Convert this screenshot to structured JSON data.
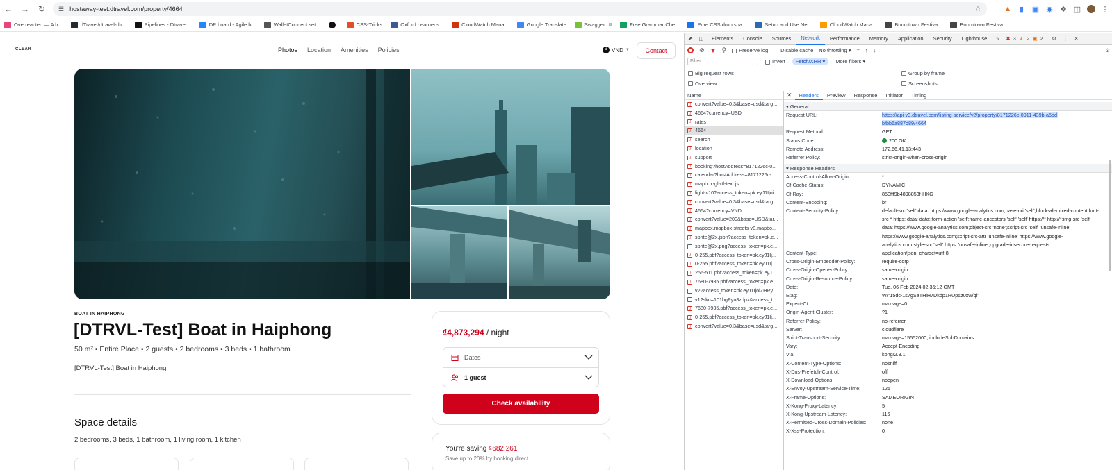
{
  "browser": {
    "url": "hostaway-test.dtravel.com/property/4664",
    "bookmarks": [
      "Overreacted — A b...",
      "dTravel/dtravel-dir...",
      "Pipelines - Dtravel...",
      "DP board - Agile b...",
      "WalletConnect set...",
      "",
      "CSS-Tricks",
      "Oxford Learner's...",
      "CloudWatch Mana...",
      "Google Translate",
      "Swagger UI",
      "Free Grammar Che...",
      "Pure CSS drop sha...",
      "Setup and Use Ne...",
      "CloudWatch Mana...",
      "Boomtown Festiva...",
      "Boomtown Festiva..."
    ],
    "bookmark_colors": [
      "#e8457a",
      "#24292e",
      "#111",
      "#2684ff",
      "#555",
      "#111",
      "#e44d26",
      "#3b5998",
      "#d13212",
      "#4285f4",
      "#7ac142",
      "#15a15d",
      "#1a73e8",
      "#2b6cb0",
      "#ff9900",
      "#444",
      "#444"
    ]
  },
  "site": {
    "logo": "CLEAR",
    "nav": [
      "Photos",
      "Location",
      "Amenities",
      "Policies"
    ],
    "currency": "VND",
    "contact": "Contact",
    "subtitle": "BOAT IN HAIPHONG",
    "title": "[DTRVL-Test] Boat in Haiphong",
    "facts": "50 m² • Entire Place • 2 guests • 2 bedrooms • 3 beds • 1 bathroom",
    "description": "[DTRVL-Test] Boat in Haiphong",
    "space_title": "Space details",
    "space_details": "2 bedrooms, 3 beds, 1 bathroom, 1 living room, 1 kitchen",
    "booking": {
      "price": "₫4,873,294",
      "per": " / night",
      "dates": "Dates",
      "guests": "1 guest",
      "cta": "Check availability"
    },
    "saving": {
      "label": "You're saving ",
      "amount": "₫682,261",
      "note": "Save up to 20% by booking direct"
    }
  },
  "devtools": {
    "tabs": [
      "Elements",
      "Console",
      "Sources",
      "Network",
      "Performance",
      "Memory",
      "Application",
      "Security",
      "Lighthouse"
    ],
    "errors": "3",
    "warnings": "2",
    "issues": "2",
    "toolbar": {
      "preserve": "Preserve log",
      "disable": "Disable cache",
      "throttle": "No throttling"
    },
    "filter": {
      "placeholder": "Filter",
      "invert": "Invert",
      "type": "Fetch/XHR",
      "more": "More filters"
    },
    "opts": {
      "big": "Big request rows",
      "overview": "Overview",
      "group": "Group by frame",
      "shots": "Screenshots"
    },
    "name_col": "Name",
    "requests": [
      "convert?value=0.3&base=usd&targ...",
      "4664?currency=USD",
      "rates",
      "4664",
      "search",
      "location",
      "support",
      "booking?hostAddress=8171226c-0...",
      "calendar?hostAddress=8171226c-...",
      "mapbox-gl-rtl-text.js",
      "light-v10?access_token=pk.eyJ1Ijoi...",
      "convert?value=0.3&base=usd&targ...",
      "4664?currency=VND",
      "convert?value=200&base=USD&tar...",
      "mapbox.mapbox-streets-v8.mapbo...",
      "sprite@2x.json?access_token=pk.e...",
      "sprite@2x.png?access_token=pk.e...",
      "0-255.pbf?access_token=pk.eyJ1Ij...",
      "0-255.pbf?access_token=pk.eyJ1Ij...",
      "256-511.pbf?access_token=pk.eyJ...",
      "7680-7935.pbf?access_token=pk.e...",
      "v2?access_token=pk.eyJ1IjoiZHRy...",
      "v1?sku=101bgPyn8zdpz&access_t...",
      "7680-7935.pbf?access_token=pk.e...",
      "0-255.pbf?access_token=pk.eyJ1Ij...",
      "convert?value=0.3&base=usd&targ..."
    ],
    "detail_tabs": [
      "Headers",
      "Preview",
      "Response",
      "Initiator",
      "Timing"
    ],
    "general_title": "General",
    "general": [
      [
        "Request URL:",
        "https://api-v3.dtravel.com/listing-service/v2/property/8171226c-0911-439b-a5dd-bfbb6a887d89/4664"
      ],
      [
        "Request Method:",
        "GET"
      ],
      [
        "Status Code:",
        "200 OK"
      ],
      [
        "Remote Address:",
        "172.66.41.13:443"
      ],
      [
        "Referrer Policy:",
        "strict-origin-when-cross-origin"
      ]
    ],
    "response_title": "Response Headers",
    "response": [
      [
        "Access-Control-Allow-Origin:",
        "*"
      ],
      [
        "Cf-Cache-Status:",
        "DYNAMIC"
      ],
      [
        "Cf-Ray:",
        "850fff9b4898853f-HKG"
      ],
      [
        "Content-Encoding:",
        "br"
      ],
      [
        "Content-Security-Policy:",
        "default-src 'self' data: https://www.google-analytics.com;base-uri 'self';block-all-mixed-content;font-src * https: data: data:;form-action 'self';frame-ancestors 'self' 'self' https://* http://*;img-src 'self' data: https://www.google-analytics.com;object-src 'none';script-src 'self' 'unsafe-inline' https://www.google-analytics.com;script-src-attr 'unsafe-inline' https://www.google-analytics.com;style-src 'self' https: 'unsafe-inline';upgrade-insecure-requests"
      ],
      [
        "Content-Type:",
        "application/json; charset=utf-8"
      ],
      [
        "Cross-Origin-Embedder-Policy:",
        "require-corp"
      ],
      [
        "Cross-Origin-Opener-Policy:",
        "same-origin"
      ],
      [
        "Cross-Origin-Resource-Policy:",
        "same-origin"
      ],
      [
        "Date:",
        "Tue, 06 Feb 2024 02:35:12 GMT"
      ],
      [
        "Etag:",
        "W/\"15dc-1s7gSaTHlH7Dkdp1RUp5z0xw/ql\""
      ],
      [
        "Expect-Ct:",
        "max-age=0"
      ],
      [
        "Origin-Agent-Cluster:",
        "?1"
      ],
      [
        "Referrer-Policy:",
        "no-referrer"
      ],
      [
        "Server:",
        "cloudflare"
      ],
      [
        "Strict-Transport-Security:",
        "max-age=15552000; includeSubDomains"
      ],
      [
        "Vary:",
        "Accept-Encoding"
      ],
      [
        "Via:",
        "kong/2.8.1"
      ],
      [
        "X-Content-Type-Options:",
        "nosniff"
      ],
      [
        "X-Dns-Prefetch-Control:",
        "off"
      ],
      [
        "X-Download-Options:",
        "noopen"
      ],
      [
        "X-Envoy-Upstream-Service-Time:",
        "125"
      ],
      [
        "X-Frame-Options:",
        "SAMEORIGIN"
      ],
      [
        "X-Kong-Proxy-Latency:",
        "5"
      ],
      [
        "X-Kong-Upstream-Latency:",
        "116"
      ],
      [
        "X-Permitted-Cross-Domain-Policies:",
        "none"
      ],
      [
        "X-Xss-Protection:",
        "0"
      ]
    ]
  },
  "colors": {
    "brand": "#d0021b",
    "devtools_accent": "#1a73e8",
    "status_ok": "#1e8e3e"
  }
}
